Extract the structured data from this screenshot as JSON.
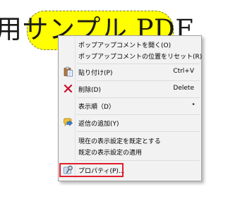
{
  "document": {
    "text": "用サンプル PDF"
  },
  "context_menu": {
    "items": [
      {
        "label": "ポップアップコメントを開く(O)"
      },
      {
        "label": "ポップアップコメントの位置をリセット(R)"
      },
      {
        "label": "貼り付け(P)",
        "shortcut": "Ctrl+V",
        "icon": "paste-icon"
      },
      {
        "label": "削除(D)",
        "shortcut": "Delete",
        "icon": "delete-icon"
      },
      {
        "label": "表示順（D）",
        "arrow": "▸"
      },
      {
        "label": "返信の追加(Y)",
        "icon": "reply-icon"
      },
      {
        "label": "現在の表示設定を既定とする"
      },
      {
        "label": "既定の表示設定の適用"
      },
      {
        "label": "プロパティ(P)...",
        "icon": "properties-icon"
      }
    ]
  },
  "colors": {
    "highlight": "#ffff00",
    "menu_background": "#f2f2f2",
    "emphasis_box": "#e01f2c",
    "delete_icon": "#c8102e"
  }
}
